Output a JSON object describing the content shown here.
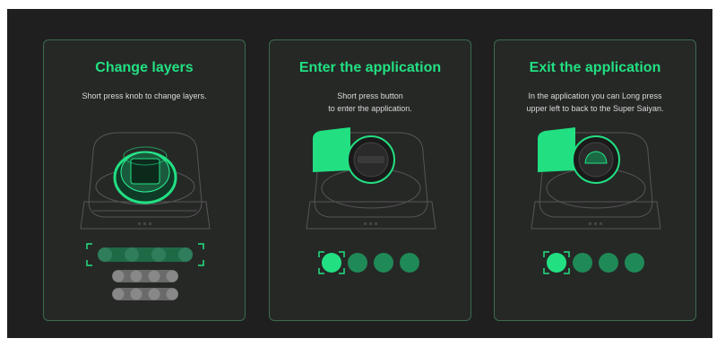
{
  "colors": {
    "accent": "#22e082",
    "background": "#1f1f1f",
    "card": "#262826",
    "dot_dim": "#1f8a57"
  },
  "cards": [
    {
      "title": "Change layers",
      "description": "Short press knob to change layers.",
      "icons": [
        "knob-device-illustration",
        "layer-selection-dots"
      ]
    },
    {
      "title": "Enter the application",
      "description": "Short press button\nto enter the application.",
      "icons": [
        "button-device-illustration",
        "app-selection-dots"
      ]
    },
    {
      "title": "Exit the application",
      "description": "In the application you can Long press\nupper left to back to the Super Saiyan.",
      "icons": [
        "exit-device-illustration",
        "app-exit-dots"
      ]
    }
  ]
}
